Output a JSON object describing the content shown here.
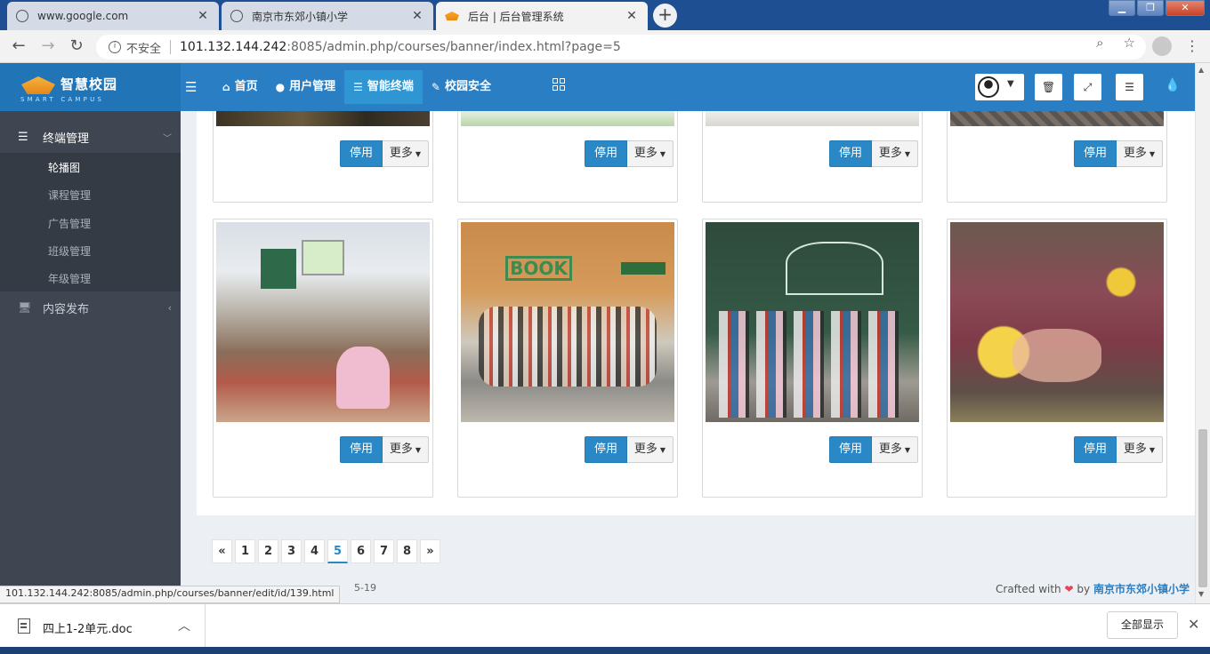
{
  "browser": {
    "tabs": [
      {
        "title": "www.google.com",
        "icon": "globe-icon"
      },
      {
        "title": "南京市东郊小镇小学",
        "icon": "globe-icon"
      },
      {
        "title": "后台 | 后台管理系统",
        "icon": "school-hat-icon"
      }
    ],
    "window_controls": {
      "minimize": "▁",
      "maximize": "❐",
      "close": "✕"
    },
    "new_tab": "+",
    "insecure_label": "不安全",
    "url_host": "101.132.144.242",
    "url_path": ":8085/admin.php/courses/banner/index.html?page=5"
  },
  "header": {
    "logo_name": "智慧校园",
    "logo_sub": "SMART CAMPUS",
    "nav": [
      {
        "label": "首页",
        "icon": "home-icon",
        "glyph": "⌂"
      },
      {
        "label": "用户管理",
        "icon": "user-icon",
        "glyph": "●"
      },
      {
        "label": "智能终端",
        "icon": "list-icon",
        "glyph": "☰"
      },
      {
        "label": "校园安全",
        "icon": "wrench-icon",
        "glyph": "✎"
      }
    ],
    "active_nav": "智能终端"
  },
  "sidebar": {
    "group_label": "终端管理",
    "items": [
      {
        "label": "轮播图"
      },
      {
        "label": "课程管理"
      },
      {
        "label": "广告管理"
      },
      {
        "label": "班级管理"
      },
      {
        "label": "年级管理"
      }
    ],
    "current_item": "轮播图",
    "group2_label": "内容发布"
  },
  "cards": {
    "stop_label": "停用",
    "more_label": "更多"
  },
  "pagination": {
    "prev": "«",
    "pages": [
      "1",
      "2",
      "3",
      "4",
      "5",
      "6",
      "7",
      "8"
    ],
    "current": "5",
    "next": "»"
  },
  "footer": {
    "left_fragment": "5-19",
    "crafted": "Crafted with",
    "heart": "❤",
    "by": "by",
    "brand": "南京市东郊小镇小学"
  },
  "status_url": "101.132.144.242:8085/admin.php/courses/banner/edit/id/139.html",
  "download": {
    "file_name": "四上1-2单元.doc",
    "show_all": "全部显示"
  },
  "colors": {
    "header_blue": "#2a7fc4",
    "sidebar_dark": "#3f4651",
    "stop_button": "#2a88c6"
  }
}
